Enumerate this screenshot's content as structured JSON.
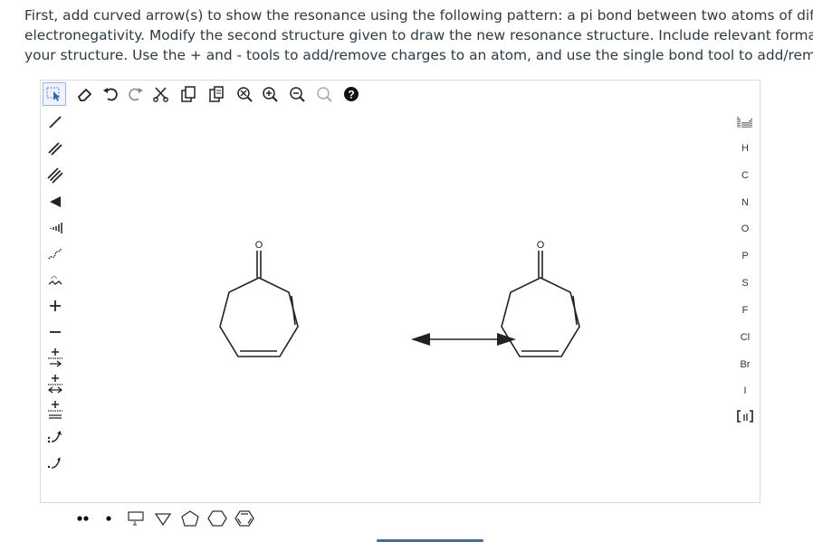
{
  "instructions": {
    "line1": "First, add curved arrow(s) to show the resonance using the following pattern: a pi bond between two atoms of differing",
    "line2": "electronegativity. Modify the second structure given to draw the new resonance structure. Include relevant formal charges in",
    "line3": "your structure. Use the + and - tools to add/remove charges to an atom, and use the single bond tool to add/remove double bor"
  },
  "top_tools": [
    "select-lasso-icon",
    "eraser-icon",
    "undo-icon",
    "redo-icon",
    "cut-icon",
    "copy-icon",
    "paste-icon",
    "clear-icon",
    "zoom-in-icon",
    "zoom-out-icon",
    "zoom-fit-icon",
    "help-icon"
  ],
  "left_tools": [
    "single-bond-icon",
    "double-bond-icon",
    "triple-bond-icon",
    "wedge-bond-icon",
    "hash-bond-icon",
    "wavy-bond-icon",
    "chain-icon",
    "plus-charge-icon",
    "minus-charge-icon",
    "add-plus-radical-icon",
    "add-plus-lone-icon",
    "add-plus-double-icon",
    "electron-pair-arrow-icon",
    "single-electron-arrow-icon"
  ],
  "elements": {
    "H": "H",
    "C": "C",
    "N": "N",
    "O": "O",
    "P": "P",
    "S": "S",
    "F": "F",
    "Cl": "Cl",
    "Br": "Br",
    "I": "I"
  },
  "structures": {
    "left_atom": "O",
    "right_atom": "O"
  },
  "bottom_tools": [
    "lone-pair-icon",
    "radical-icon",
    "cyclopropane-icon",
    "cyclobutane-icon",
    "cyclopentane-icon",
    "cyclohexane-icon",
    "benzene-icon"
  ]
}
